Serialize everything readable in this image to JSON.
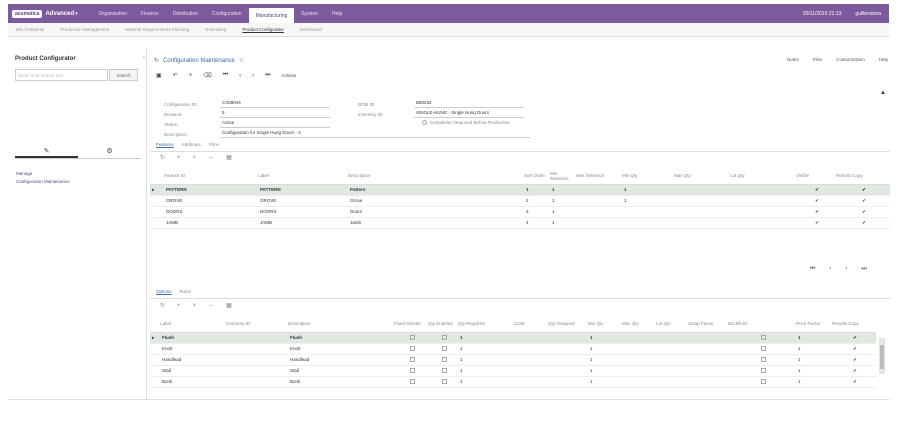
{
  "topbar": {
    "logo": "acumatica",
    "product": "Advanced",
    "modules": [
      "Organization",
      "Finance",
      "Distribution",
      "Configuration",
      "Manufacturing",
      "System",
      "Help"
    ],
    "active_module": "Manufacturing",
    "datetime": "20/11/2016 21:13",
    "user": "guillenanna"
  },
  "subnav": {
    "items": [
      "Bill of Material",
      "Production Management",
      "Material Requirements Planning",
      "Estimating",
      "Product Configurator",
      "Dashboard"
    ],
    "active": "Product Configurator"
  },
  "left": {
    "title": "Product Configurator",
    "search_placeholder": "Enter your search text",
    "search_button": "Search",
    "tab_icons": [
      "pencil-icon",
      "gear-icon"
    ],
    "links": [
      "Manage",
      "Configuration Maintenance"
    ]
  },
  "main": {
    "title": "Configuration Maintenance",
    "top_right": [
      "Notes",
      "Files",
      "Customization",
      "Help"
    ],
    "toolbar_actions": "Actions",
    "form": {
      "config_id_label": "Configuration ID:",
      "config_id": "CX89044",
      "revision_label": "Revision:",
      "revision": "5",
      "status_label": "Status:",
      "status": "Active",
      "description_label": "Description:",
      "description": "Configuration for Single Hung Doors - 2",
      "bom_label": "BOM ID:",
      "bom": "B80034",
      "inventory_label": "Inventory ID:",
      "inventory": "SINGLE-HUNG - Single Hung Doors",
      "completion": "Completion Required Before Production"
    },
    "tabs": [
      "Features",
      "Attributes",
      "Price"
    ],
    "features": {
      "headers": [
        "Feature ID",
        "Label",
        "Description",
        "Sort Order",
        "Min Selection",
        "Max Selection",
        "Min Qty",
        "Max Qty",
        "Lot Qty",
        "Visible",
        "Results Copy"
      ],
      "rows": [
        [
          "PATTERN",
          "PATTERN",
          "Pattern",
          "1",
          "1",
          "",
          "1",
          "",
          "",
          "✔",
          "✔"
        ],
        [
          "GROVE",
          "GROVE",
          "Grove",
          "2",
          "1",
          "",
          "1",
          "",
          "",
          "✔",
          "✔"
        ],
        [
          "DOORS",
          "DOORS",
          "Doors",
          "3",
          "1",
          "",
          "",
          "",
          "",
          "✔",
          "✔"
        ],
        [
          "JAMB",
          "JAMB",
          "Jamb",
          "4",
          "1",
          "",
          "",
          "",
          "",
          "✔",
          "✔"
        ]
      ]
    },
    "options_tabs": [
      "Options",
      "Rules"
    ],
    "options": {
      "headers": [
        "Label",
        "Inventory ID",
        "Description",
        "Fixed Include",
        "Qty Enabled",
        "Qty Required",
        "UOM",
        "Qty Assigned",
        "Min Qty",
        "Max Qty",
        "Lot Qty",
        "Scrap Factor",
        "Backflush",
        "Price Factor",
        "Results Copy"
      ],
      "rows": [
        [
          "Flush",
          "",
          "Flush",
          "",
          "",
          "1",
          "",
          "",
          "1",
          "",
          "",
          "",
          "",
          "1",
          "✔"
        ],
        [
          "Knob",
          "",
          "Knob",
          "",
          "",
          "1",
          "",
          "",
          "1",
          "",
          "",
          "",
          "",
          "1",
          "✔"
        ],
        [
          "Handlead",
          "",
          "Handlead",
          "",
          "",
          "1",
          "",
          "",
          "1",
          "",
          "",
          "",
          "",
          "1",
          "✔"
        ],
        [
          "Stall",
          "",
          "Stall",
          "",
          "",
          "1",
          "",
          "",
          "1",
          "",
          "",
          "",
          "",
          "1",
          "✔"
        ],
        [
          "Bonk",
          "",
          "Bonk",
          "",
          "",
          "1",
          "",
          "",
          "1",
          "",
          "",
          "",
          "",
          "1",
          "✔"
        ]
      ]
    }
  }
}
